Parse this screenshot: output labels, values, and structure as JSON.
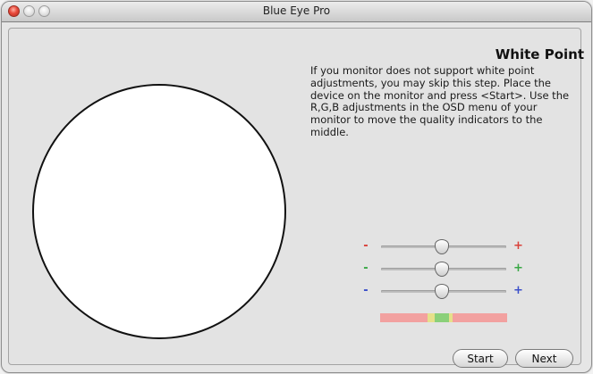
{
  "window": {
    "title": "Blue Eye Pro"
  },
  "page": {
    "heading": "White Point",
    "instructions": "If you monitor does not support white point adjustments, you may skip this step. Place the device on the monitor and press <Start>. Use the R,G,B adjustments in the OSD menu of your monitor to move the quality indicators to the middle."
  },
  "sliders": [
    {
      "channel": "R",
      "minus": "-",
      "plus": "+",
      "color": "#d9413a",
      "value": 0.5
    },
    {
      "channel": "G",
      "minus": "-",
      "plus": "+",
      "color": "#39a845",
      "value": 0.5
    },
    {
      "channel": "B",
      "minus": "-",
      "plus": "+",
      "color": "#3b4fc9",
      "value": 0.5
    }
  ],
  "quality_indicator": {
    "colors": {
      "bad": "#f2a1a0",
      "near": "#e6e08a",
      "good": "#8bd07a"
    }
  },
  "buttons": {
    "start": "Start",
    "next": "Next"
  }
}
